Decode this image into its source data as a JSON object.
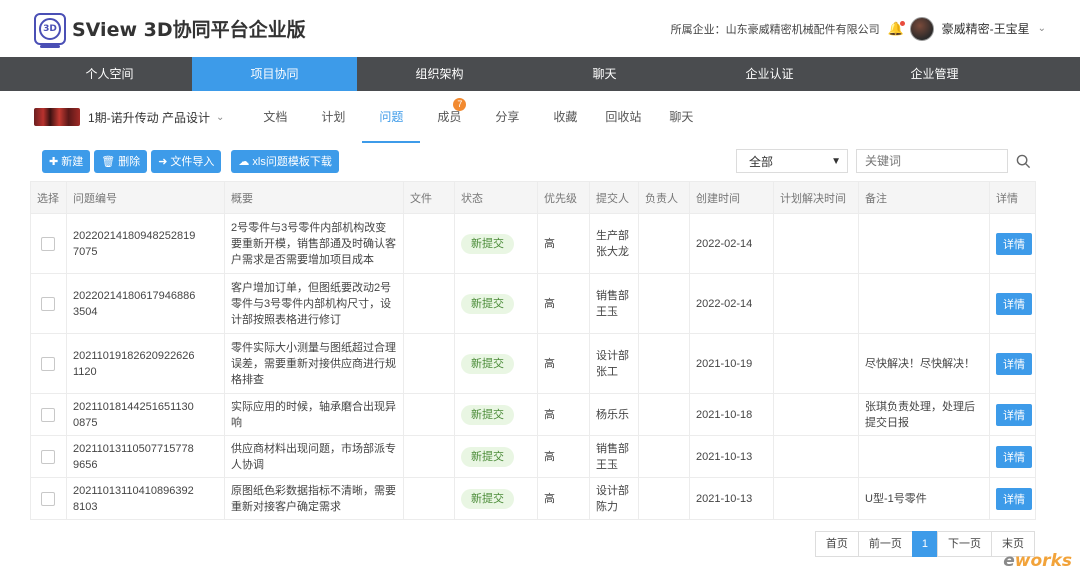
{
  "app": {
    "title": "SView 3D协同平台企业版",
    "logo_text": "3D"
  },
  "header": {
    "company_label": "所属企业：山东豪威精密机械配件有限公司",
    "user_name": "豪威精密-王宝星"
  },
  "main_nav": [
    {
      "label": "个人空间",
      "active": false
    },
    {
      "label": "项目协同",
      "active": true
    },
    {
      "label": "组织架构",
      "active": false
    },
    {
      "label": "聊天",
      "active": false
    },
    {
      "label": "企业认证",
      "active": false
    },
    {
      "label": "企业管理",
      "active": false
    }
  ],
  "project": {
    "name": "1期-诺升传动 产品设计"
  },
  "sub_tabs": [
    {
      "label": "文档",
      "badge": ""
    },
    {
      "label": "计划",
      "badge": ""
    },
    {
      "label": "问题",
      "badge": "",
      "active": true
    },
    {
      "label": "成员",
      "badge": "7"
    },
    {
      "label": "分享",
      "badge": ""
    },
    {
      "label": "收藏",
      "badge": ""
    },
    {
      "label": "回收站",
      "badge": ""
    },
    {
      "label": "聊天",
      "badge": ""
    }
  ],
  "toolbar": {
    "new_label": "新建",
    "delete_label": "删除",
    "import_label": "文件导入",
    "download_label": "xls问题模板下载",
    "filter_value": "全部",
    "search_placeholder": "关键词"
  },
  "table": {
    "headers": [
      "选择",
      "问题编号",
      "概要",
      "文件",
      "状态",
      "优先级",
      "提交人",
      "负责人",
      "创建时间",
      "计划解决时间",
      "备注",
      "详情"
    ],
    "detail_label": "详情",
    "rows": [
      {
        "id": "20220214180948252819 7075",
        "summary": "2号零件与3号零件内部机构改变要重新开模，销售部通及时确认客户需求是否需要增加项目成本",
        "file": "",
        "status": "新提交",
        "priority": "高",
        "submitter": "生产部张大龙",
        "owner": "",
        "created": "2022-02-14",
        "planned": "",
        "note": ""
      },
      {
        "id": "20220214180617946886 3504",
        "summary": "客户增加订单，但图纸要改动2号零件与3号零件内部机构尺寸，设计部按照表格进行修订",
        "file": "",
        "status": "新提交",
        "priority": "高",
        "submitter": "销售部王玉",
        "owner": "",
        "created": "2022-02-14",
        "planned": "",
        "note": ""
      },
      {
        "id": "20211019182620922626 1120",
        "summary": "零件实际大小测量与图纸超过合理误差，需要重新对接供应商进行规格排查",
        "file": "",
        "status": "新提交",
        "priority": "高",
        "submitter": "设计部张工",
        "owner": "",
        "created": "2021-10-19",
        "planned": "",
        "note": "尽快解决！尽快解决！"
      },
      {
        "id": "20211018144251651130 0875",
        "summary": "实际应用的时候，轴承磨合出现异响",
        "file": "",
        "status": "新提交",
        "priority": "高",
        "submitter": "杨乐乐",
        "owner": "",
        "created": "2021-10-18",
        "planned": "",
        "note": "张琪负责处理，处理后提交日报"
      },
      {
        "id": "20211013110507715778 9656",
        "summary": "供应商材料出现问题，市场部派专人协调",
        "file": "",
        "status": "新提交",
        "priority": "高",
        "submitter": "销售部王玉",
        "owner": "",
        "created": "2021-10-13",
        "planned": "",
        "note": ""
      },
      {
        "id": "20211013110410896392 8103",
        "summary": "原图纸色彩数据指标不清晰，需要重新对接客户确定需求",
        "file": "",
        "status": "新提交",
        "priority": "高",
        "submitter": "设计部陈力",
        "owner": "",
        "created": "2021-10-13",
        "planned": "",
        "note": "U型-1号零件"
      }
    ]
  },
  "pagination": {
    "first": "首页",
    "prev": "前一页",
    "current": "1",
    "next": "下一页",
    "last": "末页"
  },
  "watermark": {
    "text_a": "e",
    "text_b": "works"
  },
  "colors": {
    "accent": "#3d9be9",
    "nav_bg": "#4a4c4f",
    "status_bg": "#e9f6e3",
    "status_fg": "#4a8b37",
    "badge": "#f28a30"
  }
}
